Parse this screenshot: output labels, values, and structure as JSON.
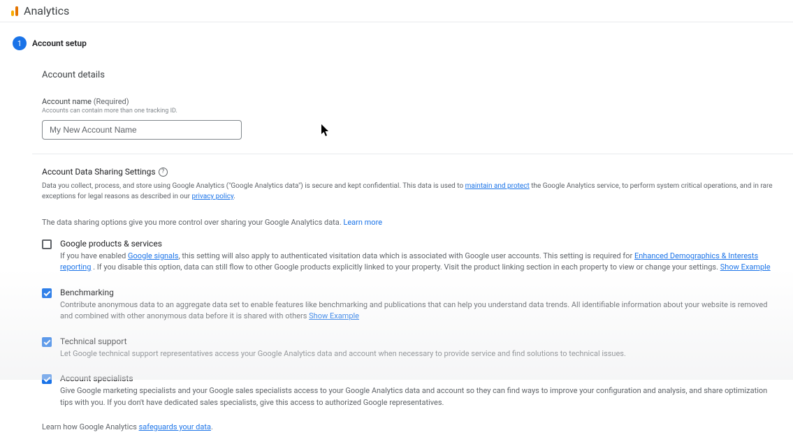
{
  "header": {
    "title": "Analytics"
  },
  "step": {
    "number": "1",
    "title": "Account setup"
  },
  "details": {
    "panel_title": "Account details",
    "name_label": "Account name",
    "required": "(Required)",
    "name_help": "Accounts can contain more than one tracking ID.",
    "name_value": "My New Account Name"
  },
  "sharing": {
    "title": "Account Data Sharing Settings",
    "desc_a": "Data you collect, process, and store using Google Analytics (\"Google Analytics data\") is secure and kept confidential. This data is used to ",
    "desc_link1": "maintain and protect",
    "desc_b": " the Google Analytics service, to perform system critical operations, and in rare exceptions for legal reasons as described in our ",
    "desc_link2": "privacy policy",
    "desc_c": ".",
    "control_text": "The data sharing options give you more control over sharing your Google Analytics data. ",
    "learn_more": "Learn more"
  },
  "options": [
    {
      "checked": false,
      "title": "Google products & services",
      "desc_a": "If you have enabled ",
      "link_a": "Google signals",
      "desc_b": ", this setting will also apply to authenticated visitation data which is associated with Google user accounts. This setting is required for ",
      "link_b": "Enhanced Demographics & Interests reporting",
      "desc_c": " . If you disable this option, data can still flow to other Google products explicitly linked to your property. Visit the product linking section in each property to view or change your settings. ",
      "example": "Show Example"
    },
    {
      "checked": true,
      "title": "Benchmarking",
      "desc_a": "Contribute anonymous data to an aggregate data set to enable features like benchmarking and publications that can help you understand data trends. All identifiable information about your website is removed and combined with other anonymous data before it is shared with others ",
      "link_a": "",
      "desc_b": "",
      "link_b": "",
      "desc_c": "",
      "example": "Show Example"
    },
    {
      "checked": true,
      "title": "Technical support",
      "desc_a": "Let Google technical support representatives access your Google Analytics data and account when necessary to provide service and find solutions to technical issues.",
      "link_a": "",
      "desc_b": "",
      "link_b": "",
      "desc_c": "",
      "example": ""
    },
    {
      "checked": true,
      "title": "Account specialists",
      "desc_a": "Give Google marketing specialists and your Google sales specialists access to your Google Analytics data and account so they can find ways to improve your configuration and analysis, and share optimization tips with you. If you don't have dedicated sales specialists, give this access to authorized Google representatives.",
      "link_a": "",
      "desc_b": "",
      "link_b": "",
      "desc_c": "",
      "example": ""
    }
  ],
  "footer": {
    "learn_a": "Learn how Google Analytics ",
    "learn_link": "safeguards your data",
    "learn_b": "."
  }
}
